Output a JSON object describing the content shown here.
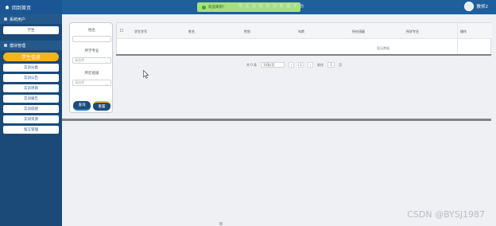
{
  "header": {
    "brand": "回到首页",
    "notice": "欢迎来到！",
    "system_title": "学 生 在 线 实 训 管 理 平 台",
    "user": "教师2"
  },
  "sidebar": {
    "sections": [
      {
        "title": "系统用户",
        "items": [
          {
            "label": "学生"
          }
        ]
      },
      {
        "title": "模块管理",
        "items": [
          {
            "label": "学生信息",
            "active": true
          },
          {
            "label": "实训分类"
          },
          {
            "label": "实训公告"
          },
          {
            "label": "实训项目"
          },
          {
            "label": "实训报告"
          },
          {
            "label": "实训成绩"
          },
          {
            "label": "实训资源"
          },
          {
            "label": "留言管理"
          }
        ]
      }
    ]
  },
  "filter": {
    "name_label": "姓名",
    "major_label": "所学专业",
    "major_placeholder": "请选择",
    "class_label": "所在班级",
    "class_placeholder": "请选择",
    "query_button": "查询",
    "reset_button": "重置"
  },
  "table": {
    "columns": [
      "学生学号",
      "姓名",
      "性别",
      "年龄",
      "所在班级",
      "所学专业",
      "操作"
    ],
    "empty_text": "暂无数据"
  },
  "pager": {
    "total_text": "共 0 条",
    "page_size": "10条/页",
    "prev": "‹",
    "current_page": "1",
    "next": "›",
    "goto_label": "前往",
    "goto_value": "1",
    "page_suffix": "页"
  },
  "watermark": "CSDN @BYSJ1987",
  "colors": {
    "header_bg": "#1f5f9c",
    "sidebar_bg": "#1b4a78",
    "accent": "#f3b51d",
    "notice_bg": "#a7e07a"
  }
}
